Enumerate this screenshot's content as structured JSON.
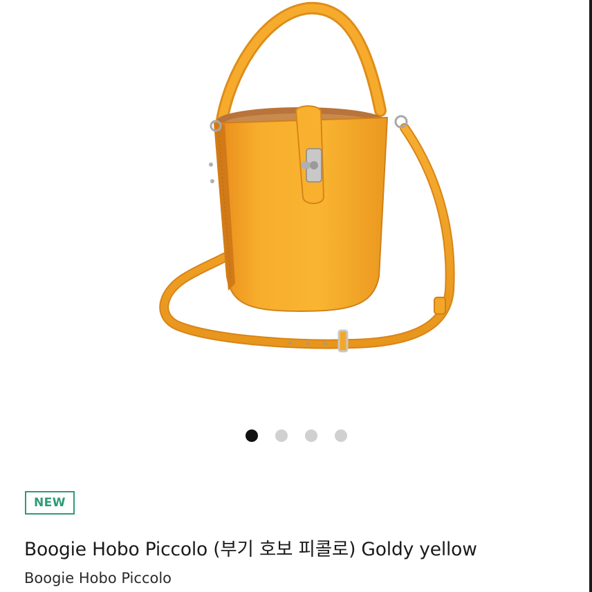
{
  "product": {
    "badge": "NEW",
    "title": "Boogie Hobo Piccolo (부기 호보 피콜로) Goldy yellow",
    "subtitle": "Boogie Hobo Piccolo",
    "image_subject": "yellow leather bucket bag with handle and crossbody strap",
    "colors": {
      "bag": "#f5a623",
      "badge": "#2e9a78"
    }
  },
  "gallery": {
    "slide_count": 4,
    "active_slide": 1
  }
}
